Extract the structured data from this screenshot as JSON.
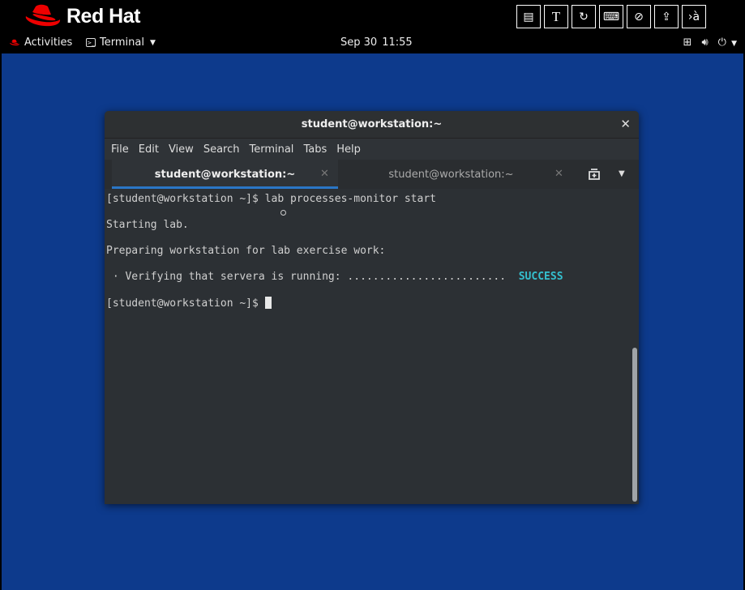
{
  "brand": {
    "name": "Red Hat"
  },
  "toolbar_icons": [
    {
      "icon": "notes-icon",
      "glyph": "▤"
    },
    {
      "icon": "text-tool-icon",
      "glyph": "T"
    },
    {
      "icon": "refresh-icon",
      "glyph": "↻"
    },
    {
      "icon": "keyboard-icon",
      "glyph": "⌨"
    },
    {
      "icon": "no-pointer-icon",
      "glyph": "⊘"
    },
    {
      "icon": "upload-icon",
      "glyph": "⇪"
    },
    {
      "icon": "input-method-icon",
      "glyph": "›à"
    }
  ],
  "panel": {
    "activities": "Activities",
    "app_menu": "Terminal",
    "date": "Sep 30",
    "time": "11:55"
  },
  "window": {
    "title": "student@workstation:~",
    "menu": [
      "File",
      "Edit",
      "View",
      "Search",
      "Terminal",
      "Tabs",
      "Help"
    ],
    "tabs": [
      {
        "label": "student@workstation:~",
        "active": true
      },
      {
        "label": "student@workstation:~",
        "active": false
      }
    ]
  },
  "terminal": {
    "line1": "[student@workstation ~]$ lab processes-monitor start",
    "line2": "Starting lab.",
    "line3": "Preparing workstation for lab exercise work:",
    "line4": " · Verifying that servera is running: .........................  ",
    "status": "SUCCESS",
    "prompt": "[student@workstation ~]$ "
  },
  "colors": {
    "desktop": "#0d3a8c",
    "success": "#35c0cf",
    "brand_red": "#ee0000",
    "tab_accent": "#2a76c6"
  }
}
